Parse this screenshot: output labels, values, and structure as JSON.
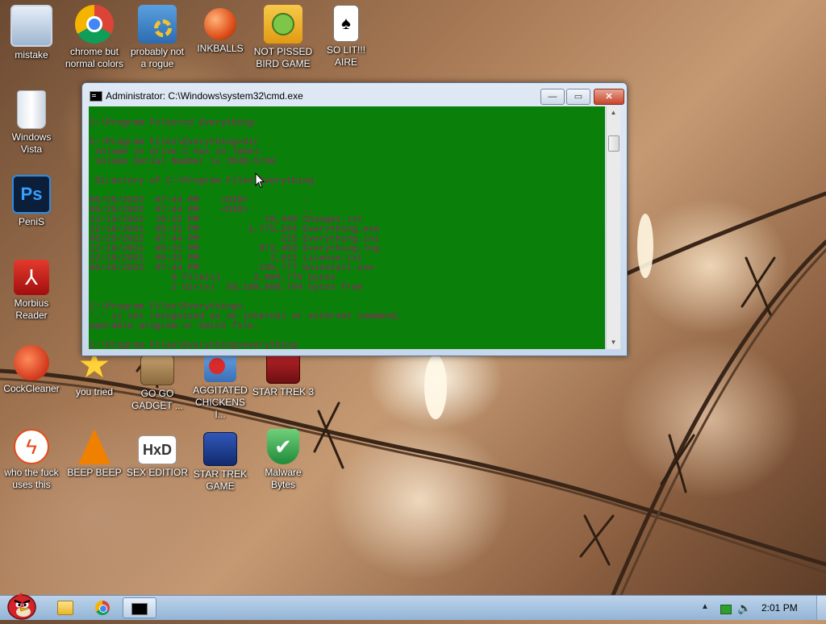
{
  "desktop": {
    "icons": [
      {
        "label": "mistake"
      },
      {
        "label": "chrome but\nnormal colors"
      },
      {
        "label": "probably not\na rogue"
      },
      {
        "label": "INKBALLS"
      },
      {
        "label": "NOT PISSED\nBIRD GAME"
      },
      {
        "label": "SO LIT!!! AIRE"
      },
      {
        "label": "Windows\nVista"
      },
      {
        "label": "PeniS"
      },
      {
        "label": "Morbius\nReader"
      },
      {
        "label": "CockCleaner"
      },
      {
        "label": "you tried"
      },
      {
        "label": "GO GO\nGADGET ..."
      },
      {
        "label": "AGGITATED\nCHICKENS I..."
      },
      {
        "label": "STAR TREK 3"
      },
      {
        "label": "who the fuck\nuses this"
      },
      {
        "label": "BEEP BEEP"
      },
      {
        "label": "SEX EDITIOR"
      },
      {
        "label": "STAR TREK\nGAME"
      },
      {
        "label": "Malware\nBytes"
      }
    ],
    "icon_names": {
      "mistake": "computer-icon",
      "chrome": "chrome-icon",
      "rogue": "gears-icon",
      "inkballs": "inkball-icon",
      "bird": "pig-icon",
      "aire": "playing-cards-icon",
      "vista": "recycle-bin-icon",
      "peni": "photoshop-icon",
      "morbius": "pdf-reader-icon",
      "cleaner": "broom-icon",
      "tried": "star-icon",
      "gadget": "box-icon",
      "chickens": "angry-birds-icon",
      "startrek3": "star-wars-icon",
      "whouses": "lightning-icon",
      "beep": "vlc-cone-icon",
      "sexeditor": "hxd-icon",
      "startrekgame": "angry-birds-star-wars-icon",
      "malware": "shield-check-icon"
    }
  },
  "cmd_window": {
    "title": "Administrator: C:\\Windows\\system32\\cmd.exe",
    "buttons": {
      "minimize": "—",
      "maximize": "▭",
      "close": "✕"
    },
    "lines": [
      "",
      "C:\\Program Files>cd Everything",
      "",
      "C:\\Program Files\\Everything>dir",
      " Volume in drive C has no label.",
      " Volume Serial Number is 2848-5746",
      "",
      " Directory of C:\\Program Files\\Everything",
      "",
      "05/25/2022  07:44 PM    <DIR>          .",
      "05/25/2022  07:44 PM    <DIR>          ..",
      "12/15/2021  10:52 PM            18,449 Changes.txt",
      "12/16/2021  05:31 PM         1,775,264 Everything.exe",
      "05/25/2022  07:44 PM               215 Everything.ini",
      "12/16/2021  05:31 PM           872,459 Everything.lng",
      "12/15/2021  05:31 PM             2,611 License.txt",
      "05/25/2022  07:44 PM           135,777 Uninstall.exe",
      "               6 File(s)      2,804,775 bytes",
      "               2 Dir(s)  59,199,688,704 bytes free",
      "",
      "C:\\Program Files\\Everything>.",
      "'.' is not recognized as an internal or external command,",
      "operable program or batch file.",
      "",
      "C:\\Program Files\\Everything>everything"
    ],
    "colors": {
      "background": "#0a800a",
      "foreground": "#a01770"
    }
  },
  "taskbar": {
    "clock": "2:01 PM",
    "start_icon": "angry-bird-start-icon",
    "pinned": [
      "folder-explorer-icon",
      "chrome-icon",
      "cmd-icon"
    ],
    "tray": [
      "show-hidden-icons-icon",
      "network-icon",
      "volume-icon"
    ]
  }
}
